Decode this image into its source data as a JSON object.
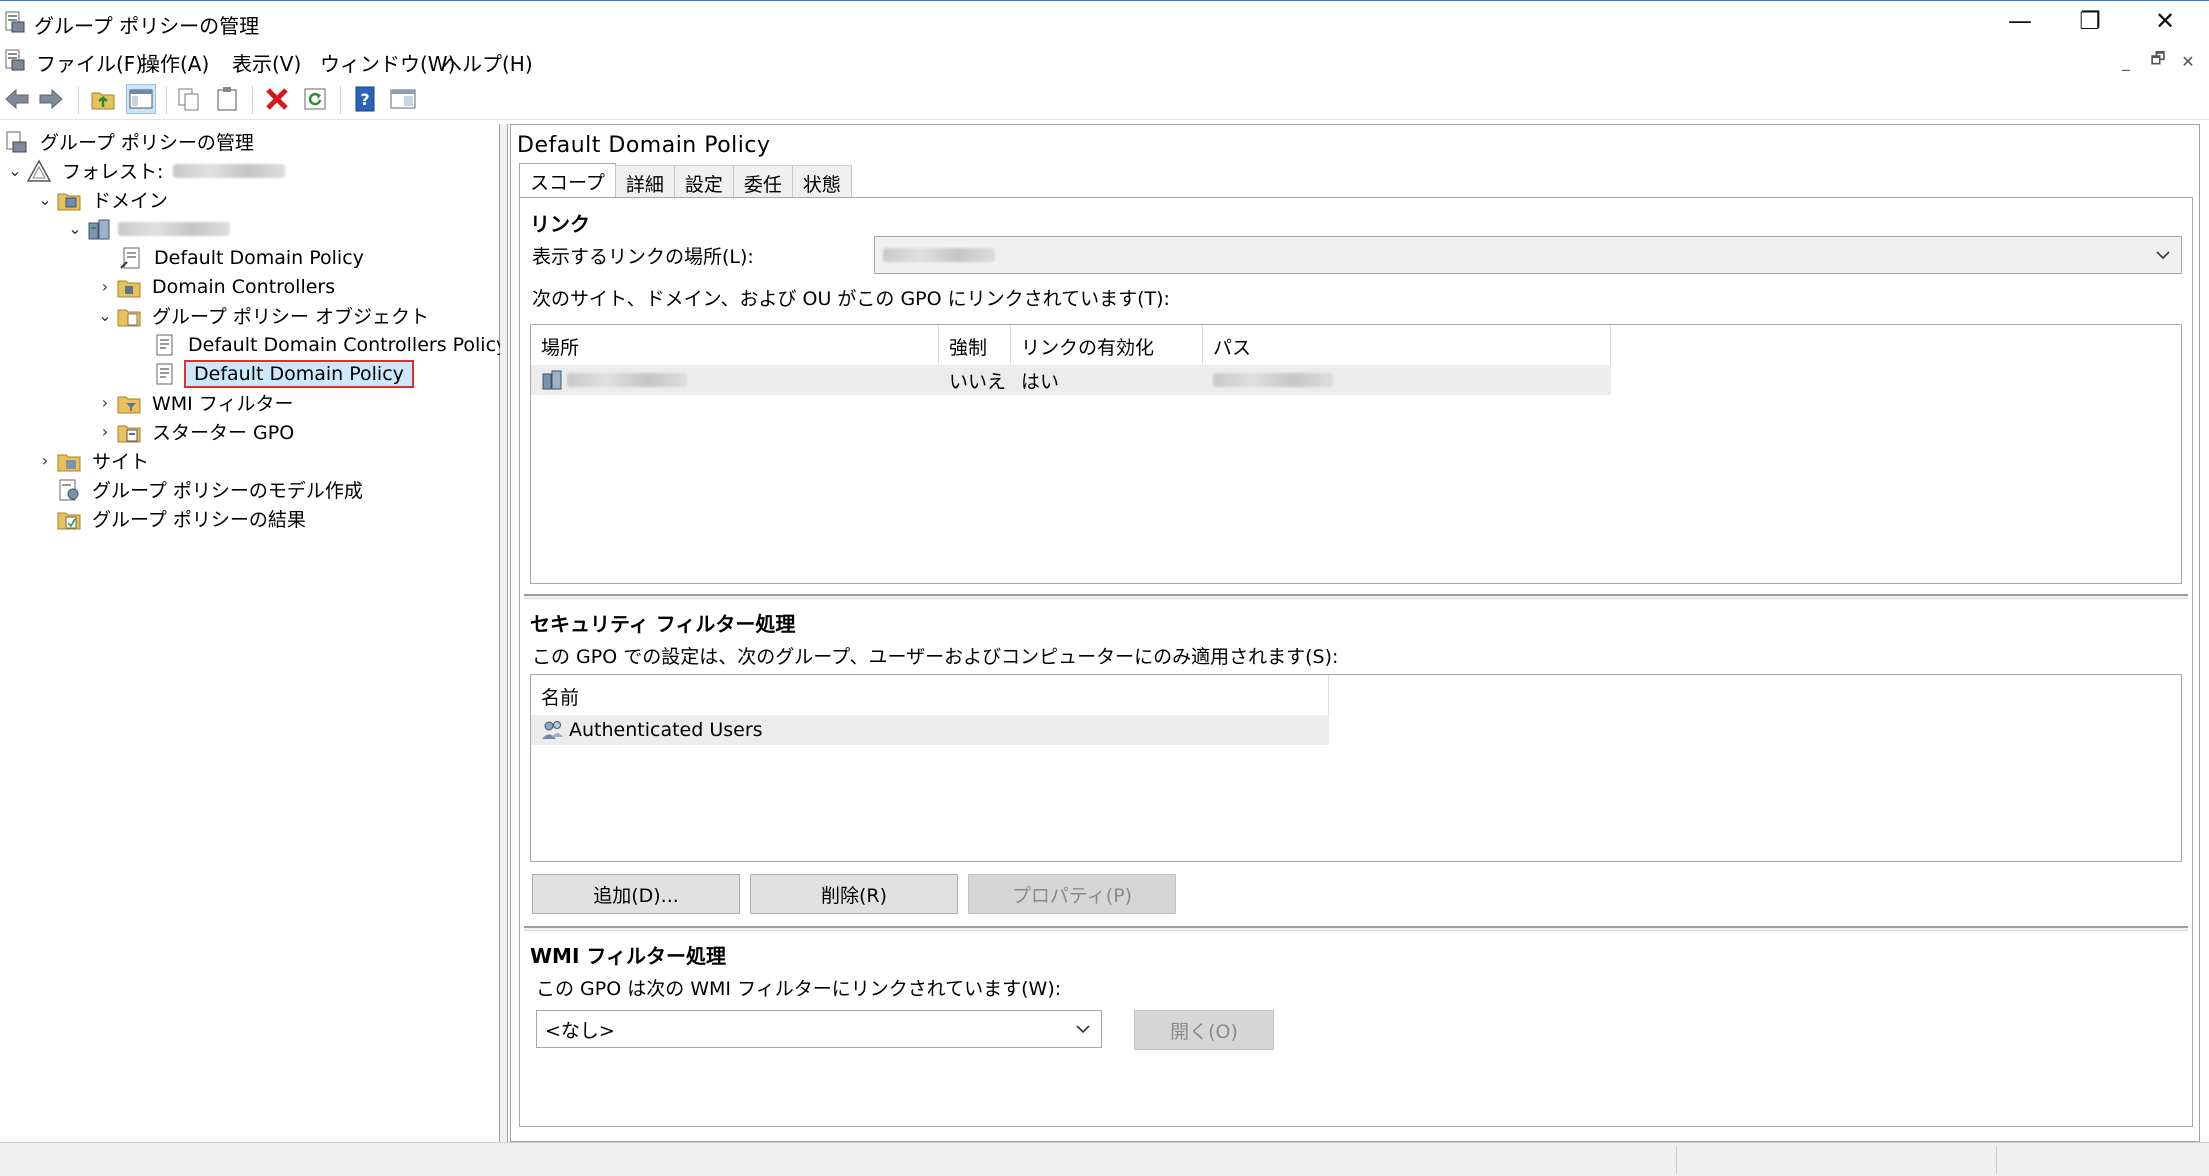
{
  "window": {
    "title": "グループ ポリシーの管理",
    "minimize": "—",
    "restore": "❐",
    "close": "✕"
  },
  "menu": {
    "items": [
      "ファイル(F)",
      "操作(A)",
      "表示(V)",
      "ウィンドウ(W)",
      "ヘルプ(H)"
    ],
    "mdi_minimize": "_",
    "mdi_restore": "🗗",
    "mdi_close": "✕"
  },
  "toolbar": {
    "icons": [
      "back-arrow-icon",
      "forward-arrow-icon",
      "up-folder-icon",
      "show-hide-tree-icon",
      "copy-icon",
      "paste-icon",
      "delete-icon",
      "refresh-icon",
      "help-icon",
      "properties-pane-icon"
    ]
  },
  "tree": {
    "root": "グループ ポリシーの管理",
    "forest_label": "フォレスト:",
    "domains_label": "ドメイン",
    "items": [
      "Default Domain Policy",
      "Domain Controllers",
      "グループ ポリシー オブジェクト",
      "Default Domain Controllers Policy",
      "Default Domain Policy",
      "WMI フィルター",
      "スターター GPO",
      "サイト",
      "グループ ポリシーのモデル作成",
      "グループ ポリシーの結果"
    ]
  },
  "right": {
    "title": "Default Domain Policy",
    "tabs": [
      "スコープ",
      "詳細",
      "設定",
      "委任",
      "状態"
    ],
    "links": {
      "heading": "リンク",
      "location_label": "表示するリンクの場所(L):",
      "description": "次のサイト、ドメイン、および OU がこの GPO にリンクされています(T):",
      "columns": [
        "場所",
        "強制",
        "リンクの有効化",
        "パス"
      ],
      "row": {
        "enforced": "いいえ",
        "enabled": "はい"
      }
    },
    "security": {
      "heading": "セキュリティ フィルター処理",
      "description": "この GPO での設定は、次のグループ、ユーザーおよびコンピューターにのみ適用されます(S):",
      "column": "名前",
      "rows": [
        "Authenticated Users"
      ],
      "add_button": "追加(D)...",
      "remove_button": "削除(R)",
      "properties_button": "プロパティ(P)"
    },
    "wmi": {
      "heading": "WMI フィルター処理",
      "description": "この GPO は次の WMI フィルターにリンクされています(W):",
      "selected": "<なし>",
      "open_button": "開く(O)"
    }
  }
}
